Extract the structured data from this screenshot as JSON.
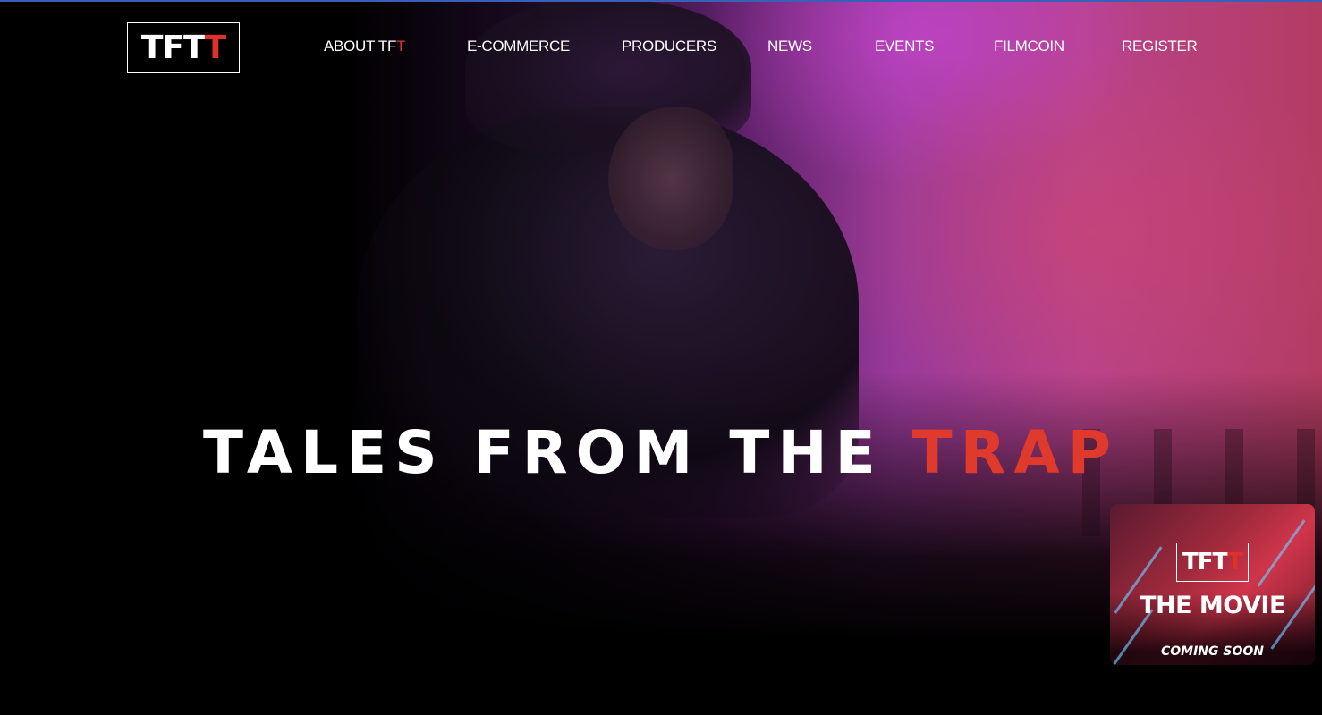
{
  "brand": {
    "logo_main": "TFT",
    "logo_accent": "T"
  },
  "nav": {
    "items": [
      {
        "label": "ABOUT TFT",
        "accent": "T"
      },
      {
        "label": "E-COMMERCE"
      },
      {
        "label": "PRODUCERS"
      },
      {
        "label": "NEWS"
      },
      {
        "label": "EVENTS"
      },
      {
        "label": "FILMCOIN"
      },
      {
        "label": "REGISTER"
      }
    ]
  },
  "hero": {
    "headline_main": "TALES FROM THE ",
    "headline_accent": "TRAP",
    "background_image": "hooded-figure-photo"
  },
  "promo": {
    "logo_main": "TFT",
    "logo_accent": "T",
    "title": "THE MOVIE",
    "subtitle": "COMING SOON"
  },
  "colors": {
    "accent_red": "#e0302a",
    "background": "#000000",
    "text": "#ffffff"
  }
}
